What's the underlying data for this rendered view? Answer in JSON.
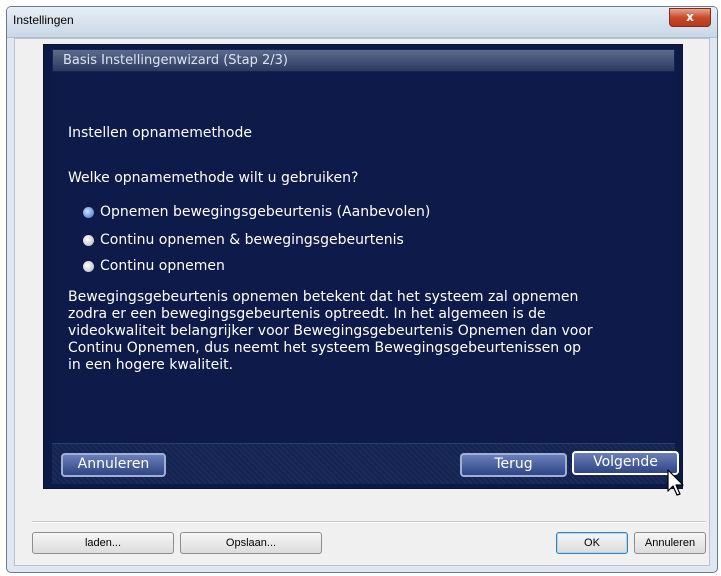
{
  "window": {
    "title": "Instellingen",
    "close_label": "x"
  },
  "wizard": {
    "header": "Basis Instellingenwizard (Stap 2/3)",
    "section_title": "Instellen opnamemethode",
    "question": "Welke opnamemethode wilt u gebruiken?",
    "options": [
      {
        "label": "Opnemen bewegingsgebeurtenis (Aanbevolen)",
        "selected": true
      },
      {
        "label": "Continu opnemen & bewegingsgebeurtenis",
        "selected": false
      },
      {
        "label": "Continu opnemen",
        "selected": false
      }
    ],
    "description": "Bewegingsgebeurtenis opnemen betekent dat het systeem zal opnemen\nzodra er een bewegingsgebeurtenis optreedt. In het algemeen is de\nvideokwaliteit belangrijker voor Bewegingsgebeurtenis Opnemen dan voor\nContinu Opnemen, dus neemt het systeem Bewegingsgebeurtenissen op\nin een hogere kwaliteit.",
    "buttons": {
      "cancel": "Annuleren",
      "back": "Terug",
      "next": "Volgende"
    }
  },
  "footer": {
    "load": "laden...",
    "save": "Opslaan...",
    "ok": "OK",
    "cancel": "Annuleren"
  },
  "colors": {
    "wizard_bg": "#0d1a4a",
    "accent_selected_radio": "#5d8fd8"
  }
}
